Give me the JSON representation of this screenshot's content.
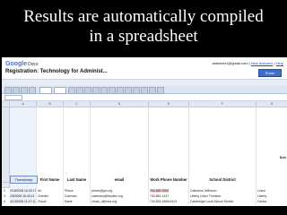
{
  "slide": {
    "title_line1": "Results are automatically compiled",
    "title_line2": "in a spreadsheet"
  },
  "app": {
    "logo": "Google",
    "logo_product": "Docs",
    "account_email": "amkober1@gmail.com",
    "account_sep": " | ",
    "account_link1": "New features!",
    "account_link2": "Help",
    "doc_title": "Registration: Technology for Administ...",
    "share_label": "Share"
  },
  "menu": [
    "File",
    "Edit",
    "View",
    "Format",
    "Insert",
    "Tools",
    "Form",
    "Help"
  ],
  "sheet": {
    "col_headers": [
      "A",
      "B",
      "C",
      "D",
      "E",
      "F",
      "G"
    ],
    "header_row": [
      "Timestamp",
      "First Name",
      "Last Name",
      "email",
      "Work Phone Number",
      "School District"
    ],
    "extra_header": "Sch",
    "rows": [
      {
        "num": "2",
        "cells": [
          "2/18/2008 16:33:17",
          "Ali",
          "Prince",
          "prince@gm.org",
          "763-669-0000",
          "Catharine Jefferson",
          "Lincol"
        ]
      },
      {
        "num": "3",
        "cells": [
          "2/8/2008 16:45:41",
          "Chester",
          "Coleman",
          "colemanc@franklin.org",
          "740-862-4137",
          "Liberty Union Thurston",
          "Liberty"
        ]
      },
      {
        "num": "4",
        "cells": [
          "4/13/2008 11:47:11",
          "Chuck",
          "Davis",
          "chuck_d@mcs.org",
          "740-829-4465x3113",
          "Cambridge Local School District",
          "Centra"
        ]
      }
    ]
  }
}
